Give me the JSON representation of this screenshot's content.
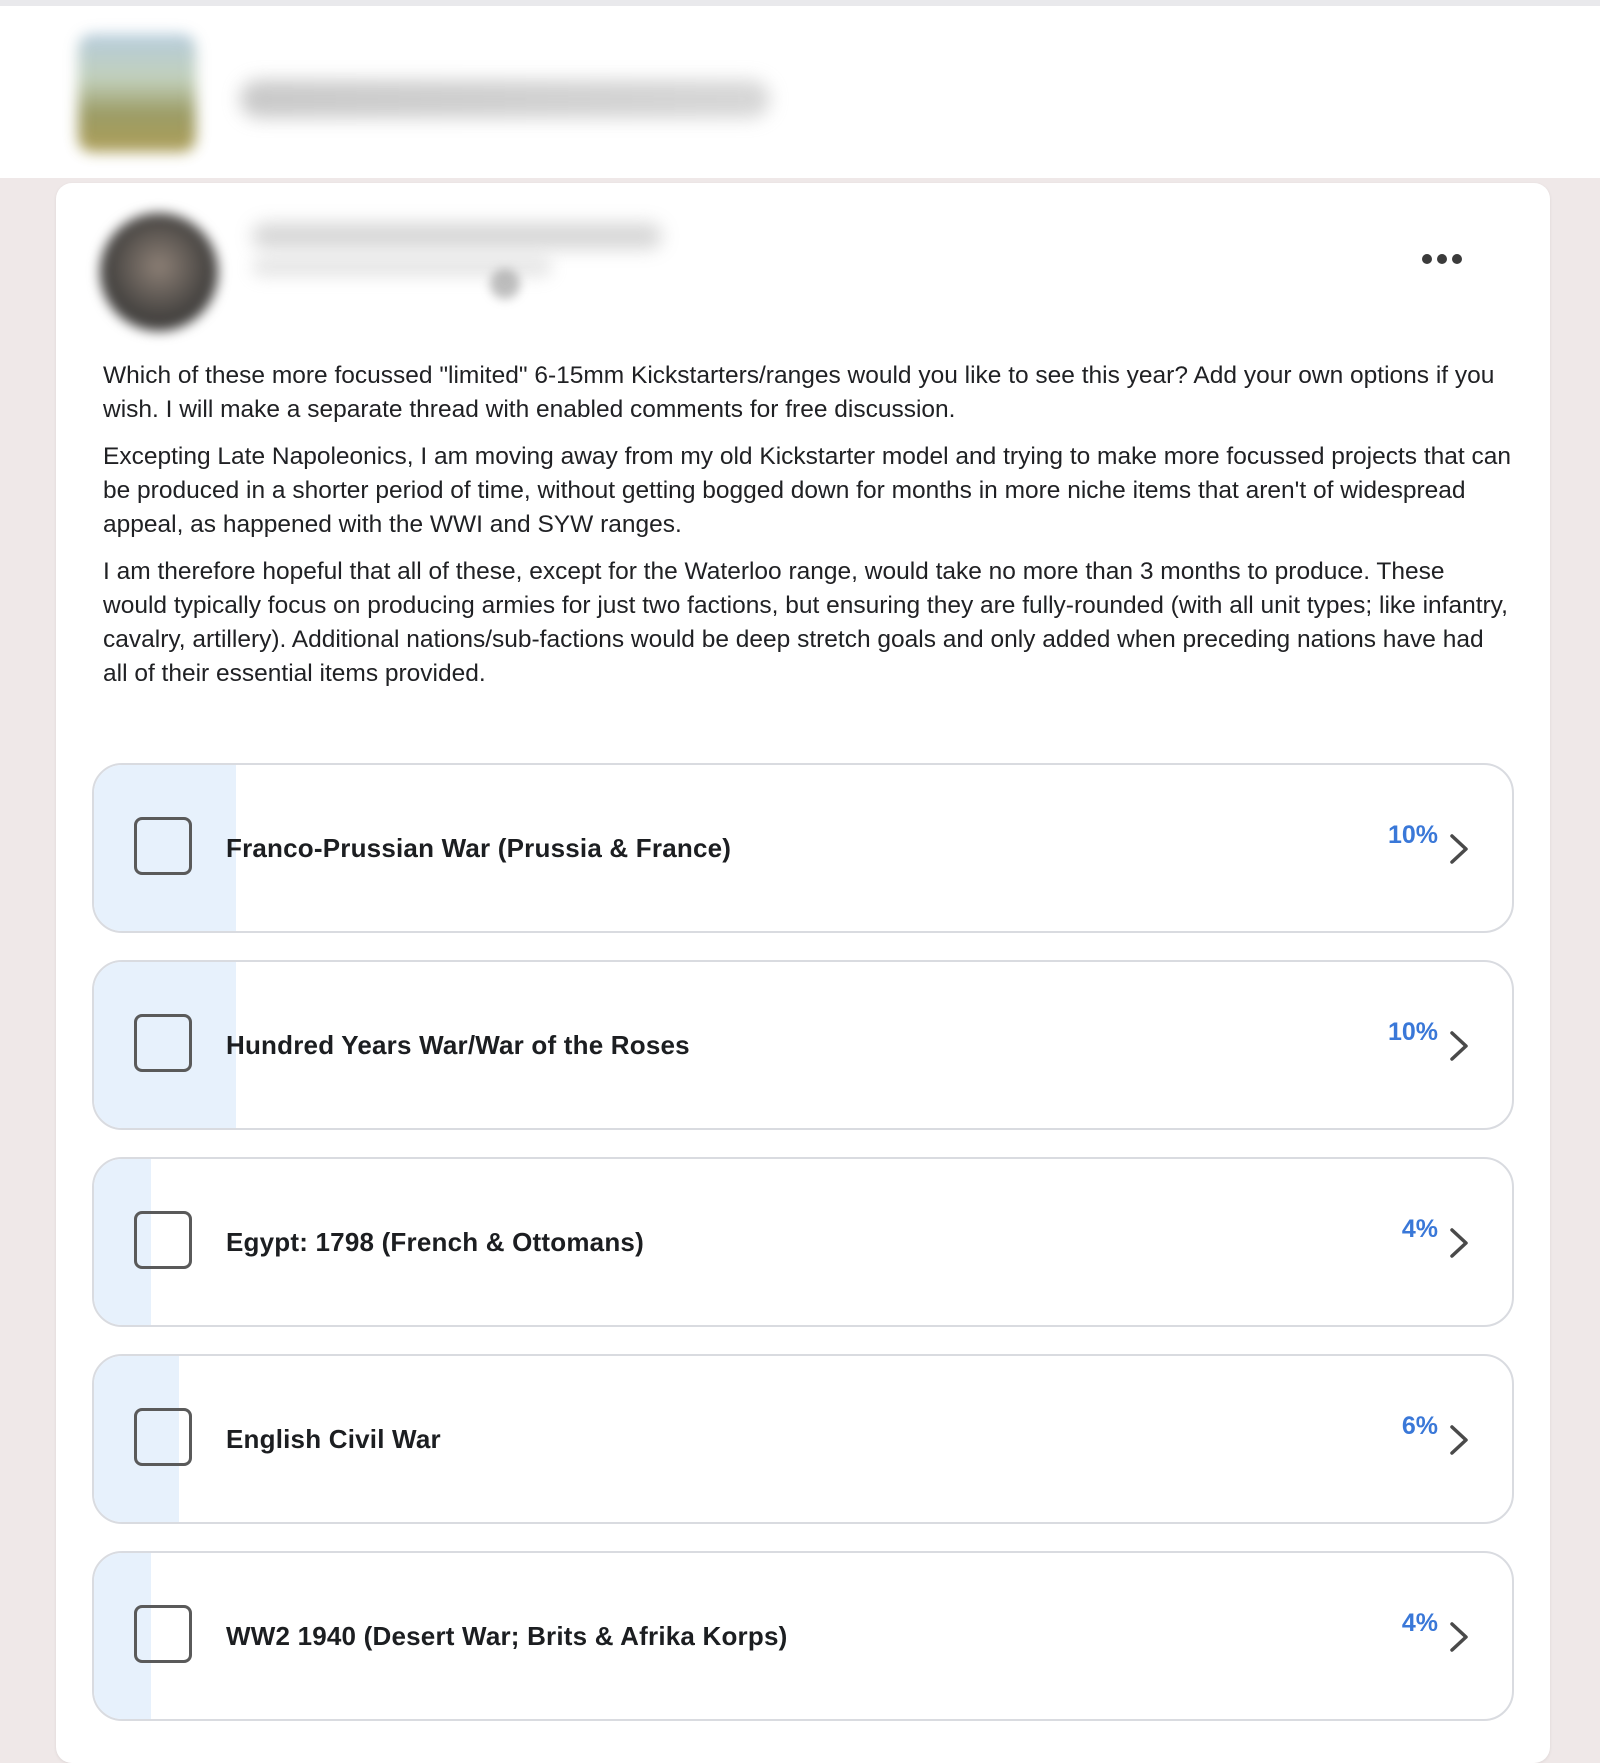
{
  "post": {
    "paragraphs": [
      "Which of these more focussed \"limited\" 6-15mm Kickstarters/ranges would you like to see this year? Add your own options if you wish. I will make a separate thread with enabled comments for free discussion.",
      "Excepting Late Napoleonics, I am moving away from my old Kickstarter model and trying to make more focussed projects that can be produced in a shorter period of time, without getting bogged down for months in more niche items that aren't of widespread appeal, as happened with the WWI and SYW ranges.",
      "I am therefore hopeful that all of these, except for the Waterloo range, would take no more than 3 months to produce. These would typically focus on producing armies for just two factions, but ensuring they are fully-rounded (with all unit types; like infantry, cavalry, artillery). Additional nations/sub-factions would be deep stretch goals and only added when preceding nations have had all of their essential items provided."
    ]
  },
  "poll": {
    "options": [
      {
        "label": "Franco-Prussian War (Prussia & France)",
        "percent": "10%",
        "fill_fraction": 0.1
      },
      {
        "label": "Hundred Years War/War of the Roses",
        "percent": "10%",
        "fill_fraction": 0.1
      },
      {
        "label": "Egypt: 1798 (French & Ottomans)",
        "percent": "4%",
        "fill_fraction": 0.04
      },
      {
        "label": "English Civil War",
        "percent": "6%",
        "fill_fraction": 0.06
      },
      {
        "label": "WW2 1940 (Desert War; Brits & Afrika Korps)",
        "percent": "4%",
        "fill_fraction": 0.04
      }
    ]
  },
  "colors": {
    "page_bg": "#efe8e8",
    "card_bg": "#ffffff",
    "poll_fill": "#e7f1fc",
    "percent_text": "#3a78d8"
  },
  "icons": {
    "more": "more-options-icon",
    "option_arrow": "chevron-right-icon"
  }
}
